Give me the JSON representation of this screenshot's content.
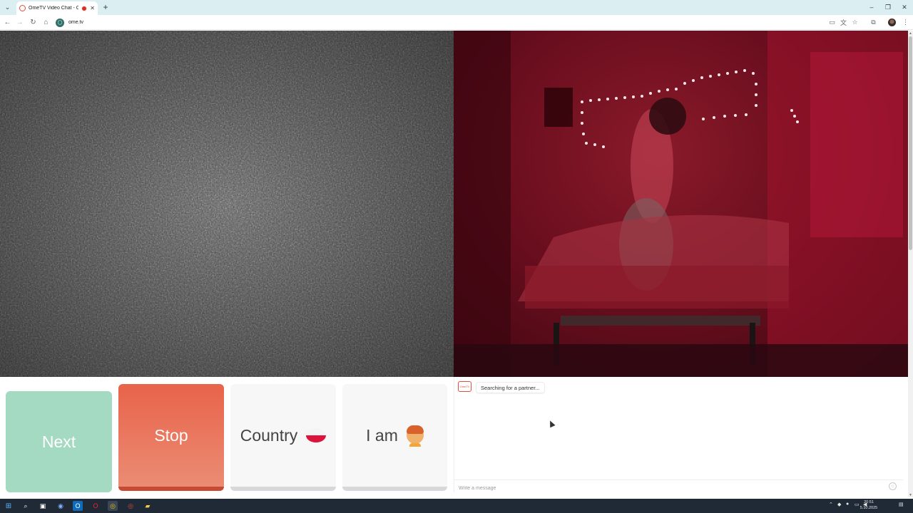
{
  "browser": {
    "tab_title": "OmeTV Video Chat - Omegle",
    "tab_close": "✕",
    "new_tab": "+",
    "url": "ome.tv",
    "site_icon_glyph": "◯"
  },
  "page": {
    "buttons": {
      "next": "Next",
      "stop": "Stop",
      "country": "Country",
      "i_am": "I am"
    },
    "country_flag": {
      "name": "Poland",
      "colors": [
        "#f4f4f4",
        "#dc143c"
      ]
    },
    "chat": {
      "logo_text": "OmeTV",
      "status_message": "Searching for a partner...",
      "input_placeholder": "Write a message"
    }
  },
  "taskbar": {
    "icons": [
      "windows-logo-icon",
      "search-icon",
      "task-view-icon",
      "copilot-icon",
      "outlook-icon",
      "opera-icon",
      "chrome-icon",
      "chrome-alt-icon",
      "file-explorer-icon"
    ],
    "clock_time": "20:51",
    "clock_date": "5.10.2025"
  },
  "colors": {
    "next": "#a3dac1",
    "stop": "#e8634a",
    "accent": "#e54b3c",
    "taskbar": "#1f2a36"
  }
}
